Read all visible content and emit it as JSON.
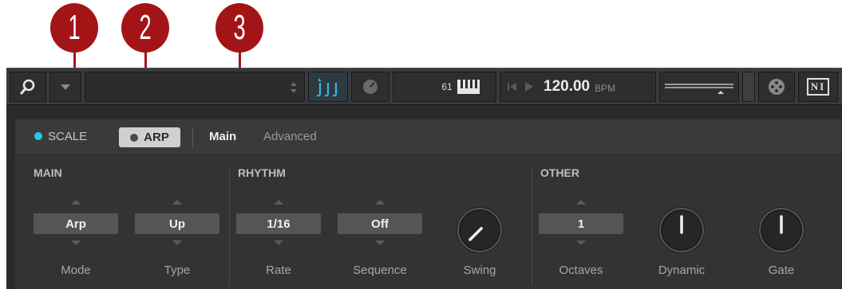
{
  "callouts": [
    "1",
    "2",
    "3"
  ],
  "toolbar": {
    "search_icon": "search-icon",
    "midi_channel": "61",
    "tempo_value": "120.00",
    "tempo_unit": "BPM",
    "logo_text": "NI"
  },
  "tabs": {
    "scale_label": "SCALE",
    "arp_label": "ARP",
    "main_label": "Main",
    "advanced_label": "Advanced"
  },
  "sections": {
    "main": {
      "label": "MAIN",
      "controls": [
        {
          "value": "Arp",
          "label": "Mode"
        },
        {
          "value": "Up",
          "label": "Type"
        }
      ]
    },
    "rhythm": {
      "label": "RHYTHM",
      "controls": [
        {
          "value": "1/16",
          "label": "Rate"
        },
        {
          "value": "Off",
          "label": "Sequence"
        }
      ],
      "knob": {
        "label": "Swing",
        "level": 0.0
      }
    },
    "other": {
      "label": "OTHER",
      "controls": [
        {
          "value": "1",
          "label": "Octaves"
        }
      ],
      "knobs": [
        {
          "label": "Dynamic",
          "level": 0.5
        },
        {
          "label": "Gate",
          "level": 0.5
        }
      ]
    }
  },
  "colors": {
    "callout": "#a31417",
    "scale_dot": "#1ec8f0",
    "accent": "#3ab4e6"
  }
}
